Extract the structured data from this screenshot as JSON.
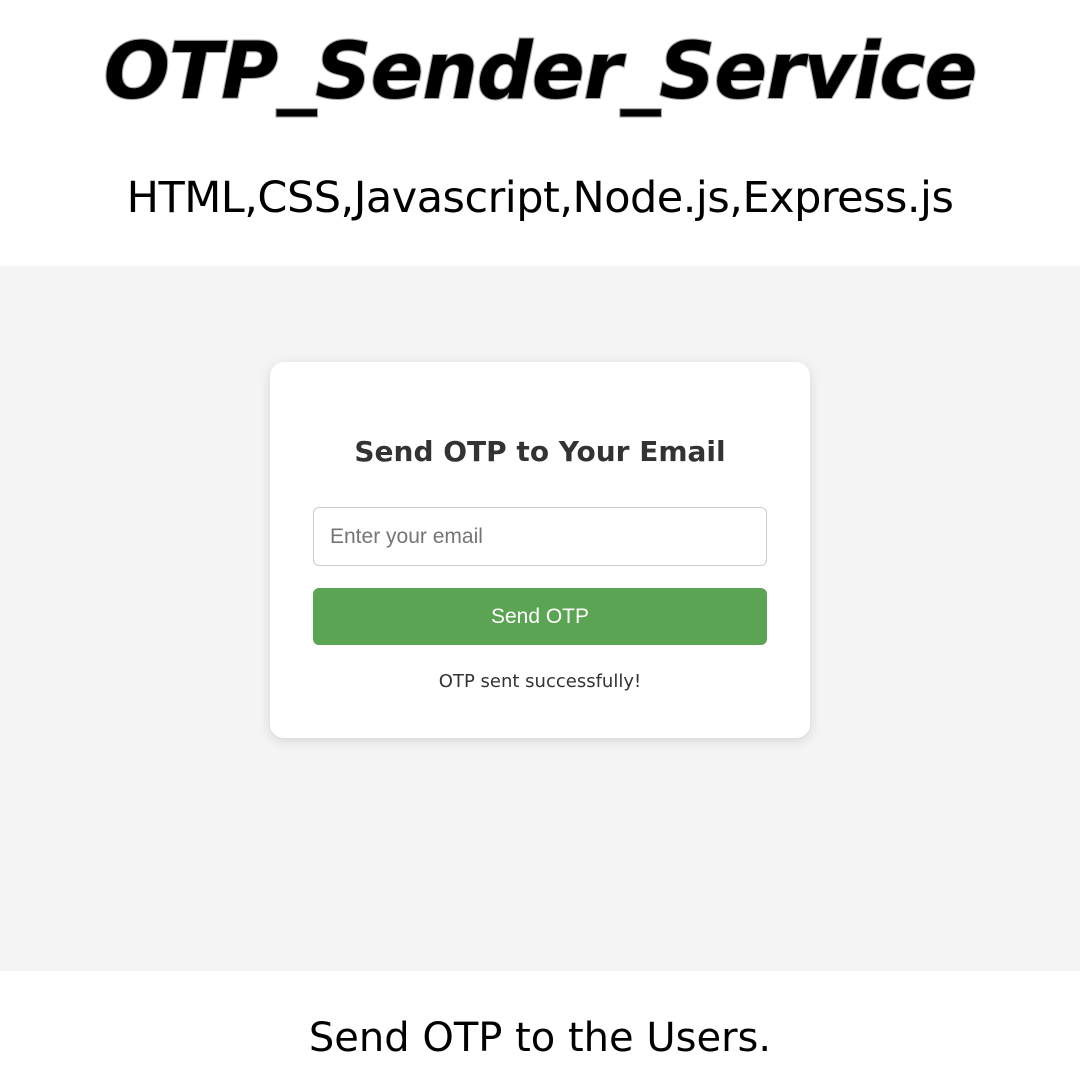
{
  "banner": {
    "title": "OTP_Sender_Service",
    "subtitle": "HTML,CSS,Javascript,Node.js,Express.js",
    "footer": "Send OTP to the Users."
  },
  "app": {
    "heading": "Send OTP to Your Email",
    "email_input": {
      "placeholder": "Enter your email",
      "value": ""
    },
    "send_button_label": "Send OTP",
    "status_message": "OTP sent successfully!"
  },
  "colors": {
    "page_background": "#f4f4f4",
    "card_background": "#ffffff",
    "button_background": "#5ba453",
    "button_text": "#ffffff",
    "heading_text": "#333333"
  }
}
